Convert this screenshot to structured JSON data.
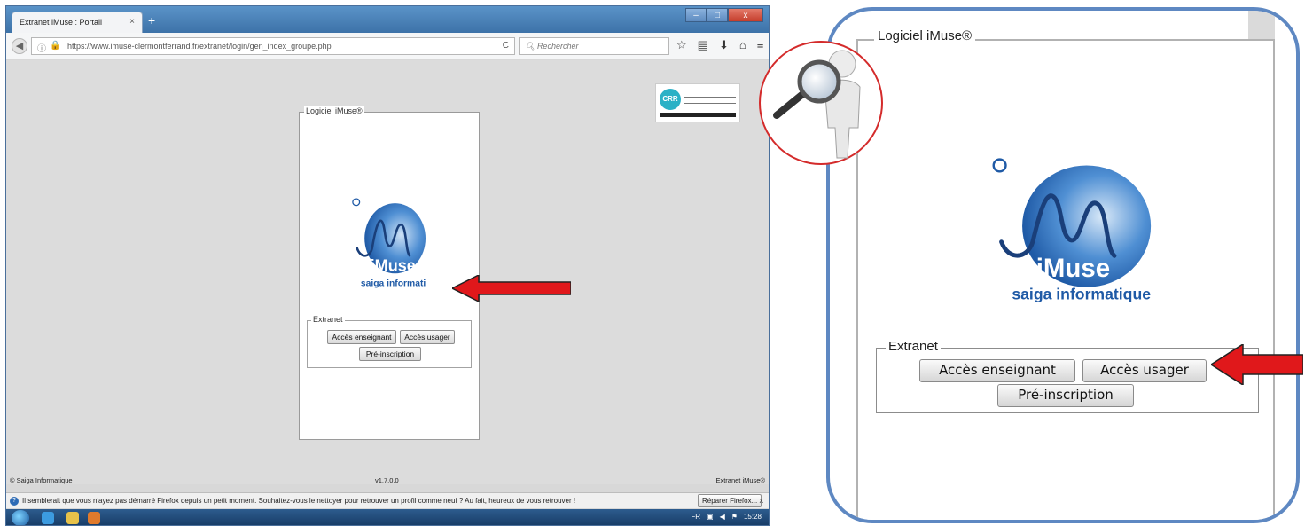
{
  "browser": {
    "tab_title": "Extranet iMuse : Portail",
    "tab_close": "×",
    "new_tab": "+",
    "window_buttons": {
      "minimize": "–",
      "maximize": "□",
      "close": "x"
    },
    "url": "https://www.imuse-clermontferrand.fr/extranet/login/gen_index_groupe.php",
    "reload_glyph": "C",
    "search_placeholder": "Rechercher",
    "toolbar_icons": [
      "star-icon",
      "reading-list-icon",
      "download-icon",
      "home-icon",
      "menu-icon"
    ]
  },
  "page": {
    "panel_title": "Logiciel iMuse®",
    "logo_brand": "iMuse",
    "logo_tagline": "saiga informatique",
    "extranet_legend": "Extranet",
    "buttons": {
      "teacher": "Accès enseignant",
      "user": "Accès usager",
      "preregistration": "Pré-inscription"
    },
    "crr_logo_text": "CRR"
  },
  "footer": {
    "left": "© Saiga Informatique",
    "version": "v1.7.0.0",
    "right": "Extranet iMuse®"
  },
  "notification": {
    "message": "Il semblerait que vous n'ayez pas démarré Firefox depuis un petit moment. Souhaitez-vous le nettoyer pour retrouver un profil comme neuf ? Au fait, heureux de vous retrouver !",
    "button": "Réparer Firefox...",
    "close": "x"
  },
  "taskbar": {
    "language": "FR",
    "clock": "15:28"
  },
  "zoom": {
    "panel_title": "Logiciel iMuse®",
    "logo_brand": "iMuse",
    "logo_tagline": "saiga informatique",
    "extranet_legend": "Extranet",
    "buttons": {
      "teacher": "Accès enseignant",
      "user": "Accès usager",
      "preregistration": "Pré-inscription"
    }
  },
  "colors": {
    "highlight_arrow": "#e0181b",
    "zoom_border": "#5e88c2",
    "magnifier_ring": "#d42b2b",
    "logo_blue": "#2a6db8"
  }
}
